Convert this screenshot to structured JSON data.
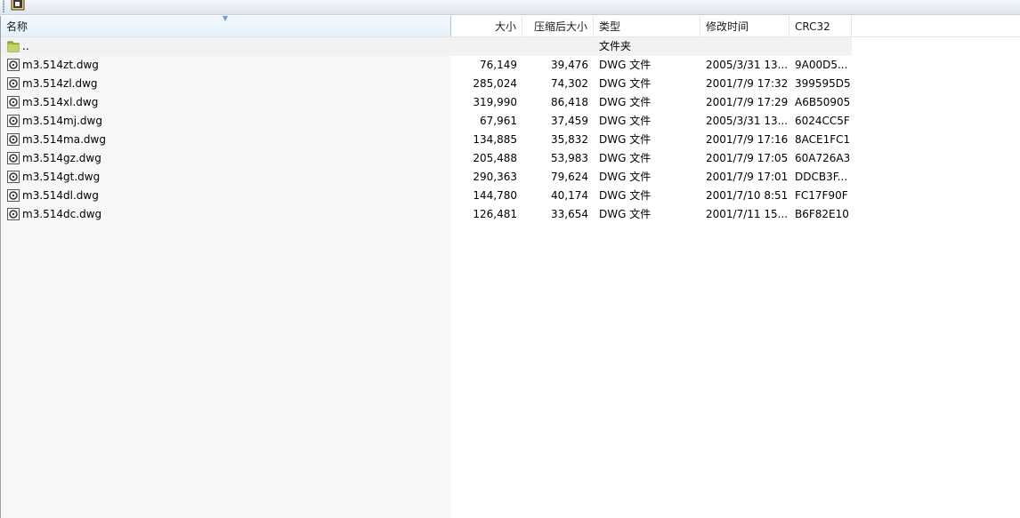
{
  "columns": {
    "name": "名称",
    "size": "大小",
    "packed": "压缩后大小",
    "type": "类型",
    "modified": "修改时间",
    "crc": "CRC32"
  },
  "parent_row": {
    "name": "..",
    "type": "文件夹"
  },
  "files": [
    {
      "name": "m3.514zt.dwg",
      "size": "76,149",
      "packed": "39,476",
      "type": "DWG 文件",
      "modified": "2005/3/31 13...",
      "crc": "9A00D5..."
    },
    {
      "name": "m3.514zl.dwg",
      "size": "285,024",
      "packed": "74,302",
      "type": "DWG 文件",
      "modified": "2001/7/9 17:32",
      "crc": "399595D5"
    },
    {
      "name": "m3.514xl.dwg",
      "size": "319,990",
      "packed": "86,418",
      "type": "DWG 文件",
      "modified": "2001/7/9 17:29",
      "crc": "A6B50905"
    },
    {
      "name": "m3.514mj.dwg",
      "size": "67,961",
      "packed": "37,459",
      "type": "DWG 文件",
      "modified": "2005/3/31 13...",
      "crc": "6024CC5F"
    },
    {
      "name": "m3.514ma.dwg",
      "size": "134,885",
      "packed": "35,832",
      "type": "DWG 文件",
      "modified": "2001/7/9 17:16",
      "crc": "8ACE1FC1"
    },
    {
      "name": "m3.514gz.dwg",
      "size": "205,488",
      "packed": "53,983",
      "type": "DWG 文件",
      "modified": "2001/7/9 17:05",
      "crc": "60A726A3"
    },
    {
      "name": "m3.514gt.dwg",
      "size": "290,363",
      "packed": "79,624",
      "type": "DWG 文件",
      "modified": "2001/7/9 17:01",
      "crc": "DDCB3F..."
    },
    {
      "name": "m3.514dl.dwg",
      "size": "144,780",
      "packed": "40,174",
      "type": "DWG 文件",
      "modified": "2001/7/10 8:51",
      "crc": "FC17F90F"
    },
    {
      "name": "m3.514dc.dwg",
      "size": "126,481",
      "packed": "33,654",
      "type": "DWG 文件",
      "modified": "2001/7/11 15...",
      "crc": "B6F82E10"
    }
  ],
  "icons": {
    "toolbar": "extract-button-icon",
    "parent": "folder-up-icon",
    "file": "dwg-file-icon",
    "sort": "sort-ascending-icon"
  },
  "colors": {
    "sorted_header": "#e4f1fb",
    "sorted_column_bg": "#f7f7f7",
    "folder_icon": "#9fb33a"
  }
}
